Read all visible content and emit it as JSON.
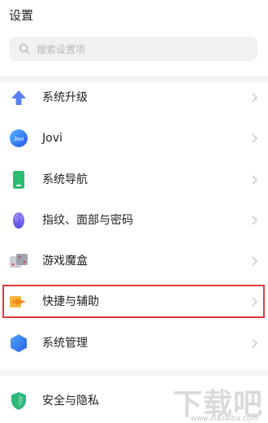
{
  "header": {
    "title": "设置"
  },
  "search": {
    "placeholder": "搜索设置项"
  },
  "items": [
    {
      "label": "系统升级",
      "icon": "arrow-up-icon"
    },
    {
      "label": "Jovi",
      "icon": "jovi-icon"
    },
    {
      "label": "系统导航",
      "icon": "phone-icon"
    },
    {
      "label": "指纹、面部与密码",
      "icon": "fingerprint-icon"
    },
    {
      "label": "游戏魔盒",
      "icon": "dice-icon"
    },
    {
      "label": "快捷与辅助",
      "icon": "shortcut-arrow-icon"
    },
    {
      "label": "系统管理",
      "icon": "hexagon-icon"
    },
    {
      "label": "安全与隐私",
      "icon": "shield-icon"
    }
  ],
  "watermark": {
    "text": "下载吧",
    "url": "www.xiazaiba.com"
  },
  "colors": {
    "highlight": "#e13a3a",
    "accent_blue": "#3d7cf5",
    "green": "#2db87a"
  }
}
